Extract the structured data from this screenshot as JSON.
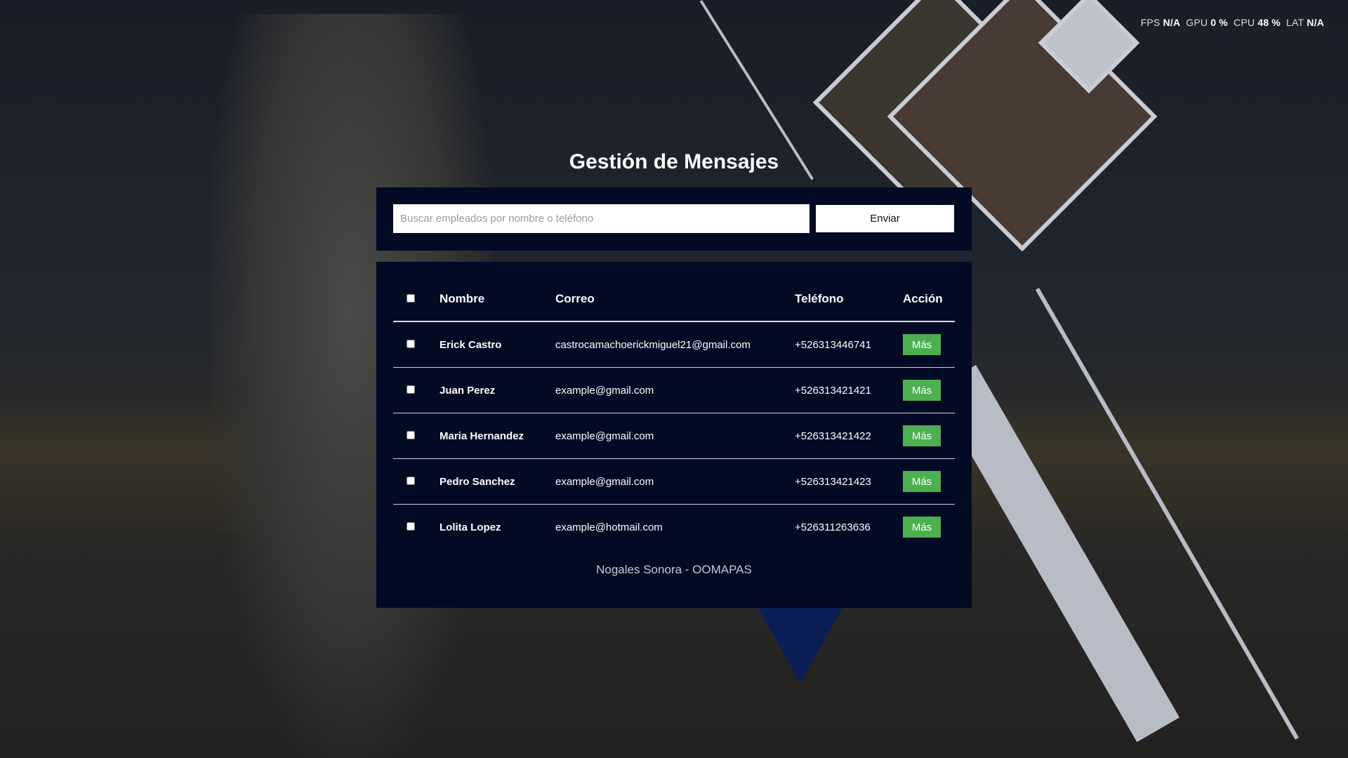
{
  "hud": {
    "fps_label": "FPS",
    "fps": "N/A",
    "gpu_label": "GPU",
    "gpu": "0 %",
    "cpu_label": "CPU",
    "cpu": "48 %",
    "lat_label": "LAT",
    "lat": "N/A"
  },
  "title": "Gestión de Mensajes",
  "search": {
    "placeholder": "Buscar empleados por nombre o teléfono",
    "value": "",
    "button": "Enviar"
  },
  "table": {
    "headers": {
      "name": "Nombre",
      "email": "Correo",
      "phone": "Teléfono",
      "action": "Acción"
    },
    "rows": [
      {
        "name": "Erick Castro",
        "email": "castrocamachoerickmiguel21@gmail.com",
        "phone": "+526313446741",
        "action": "Más"
      },
      {
        "name": "Juan Perez",
        "email": "example@gmail.com",
        "phone": "+526313421421",
        "action": "Más"
      },
      {
        "name": "Maria Hernandez",
        "email": "example@gmail.com",
        "phone": "+526313421422",
        "action": "Más"
      },
      {
        "name": "Pedro Sanchez",
        "email": "example@gmail.com",
        "phone": "+526313421423",
        "action": "Más"
      },
      {
        "name": "Lolita Lopez",
        "email": "example@hotmail.com",
        "phone": "+526311263636",
        "action": "Más"
      }
    ]
  },
  "footer": "Nogales Sonora - OOMAPAS",
  "colors": {
    "panel": "#030a24",
    "accent": "#4caf50"
  }
}
